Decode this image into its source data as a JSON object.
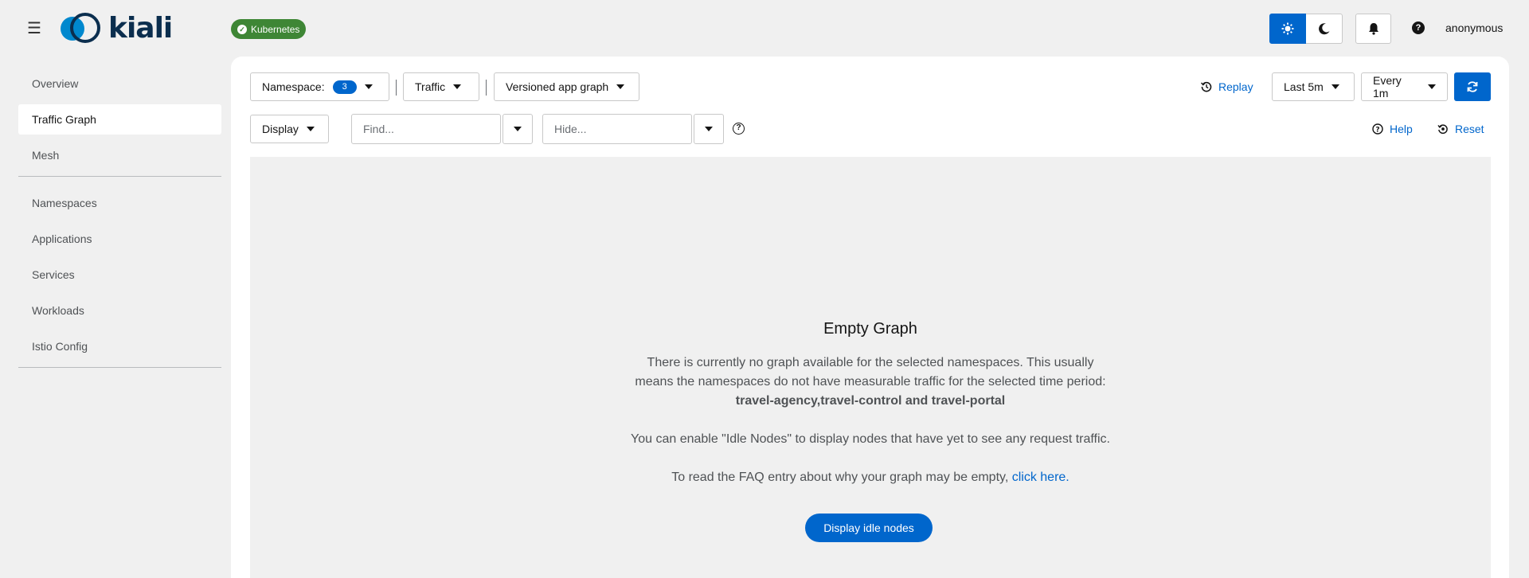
{
  "header": {
    "menu_icon": "hamburger-menu-icon",
    "logo_text": "kiali",
    "cluster_badge": "Kubernetes",
    "user": "anonymous",
    "accent_color": "#0066cc"
  },
  "sidebar": {
    "items": [
      {
        "label": "Overview"
      },
      {
        "label": "Traffic Graph",
        "active": true
      },
      {
        "label": "Mesh"
      },
      {
        "label": "Namespaces"
      },
      {
        "label": "Applications"
      },
      {
        "label": "Services"
      },
      {
        "label": "Workloads"
      },
      {
        "label": "Istio Config"
      }
    ]
  },
  "toolbar": {
    "namespace_label": "Namespace:",
    "namespace_count": "3",
    "traffic_label": "Traffic",
    "graph_type_label": "Versioned app graph",
    "replay_label": "Replay",
    "duration_label": "Last 5m",
    "refresh_interval_label": "Every 1m",
    "display_label": "Display",
    "find_placeholder": "Find...",
    "hide_placeholder": "Hide...",
    "help_label": "Help",
    "reset_label": "Reset"
  },
  "empty_graph": {
    "title": "Empty Graph",
    "line1": "There is currently no graph available for the selected namespaces. This usually",
    "line2": "means the namespaces do not have measurable traffic for the selected time period:",
    "namespaces": "travel-agency,travel-control and travel-portal",
    "idle_hint": "You can enable \"Idle Nodes\" to display nodes that have yet to see any request traffic.",
    "faq_prefix": "To read the FAQ entry about why your graph may be empty,",
    "faq_link": "click here.",
    "idle_button": "Display idle nodes"
  }
}
